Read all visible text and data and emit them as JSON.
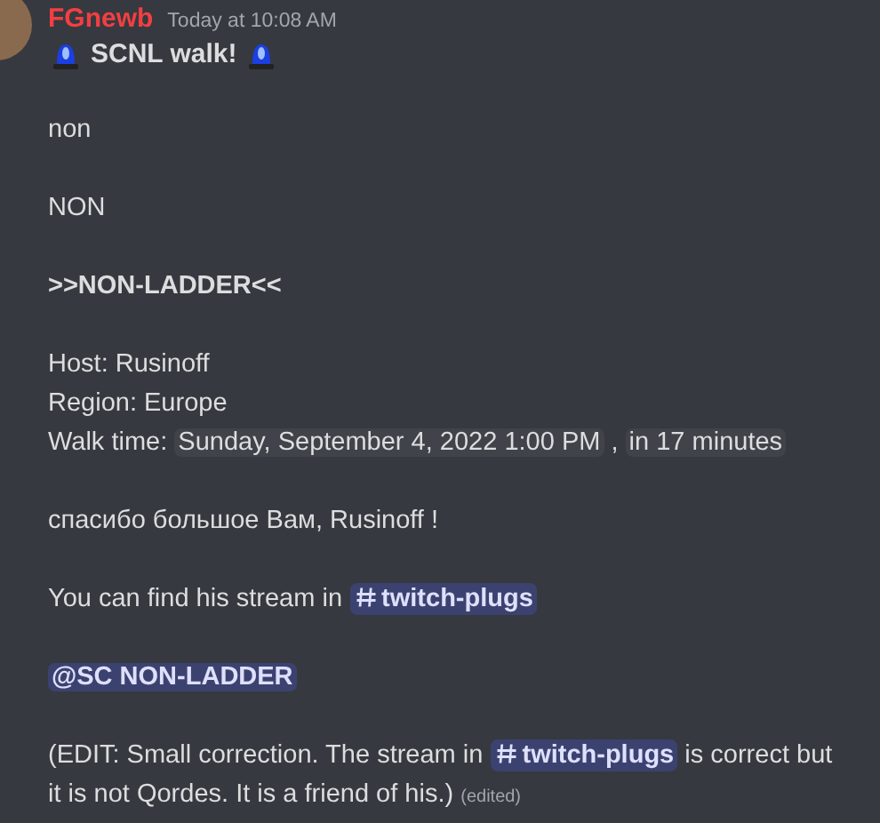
{
  "message": {
    "author": "FGnewb",
    "timestamp": "Today at 10:08 AM",
    "title": "SCNL walk!",
    "blocks": [
      [
        [
          {
            "kind": "text",
            "text": "non"
          }
        ]
      ],
      [
        [
          {
            "kind": "text",
            "text": "NON"
          }
        ]
      ],
      [
        [
          {
            "kind": "bold",
            "text": ">>NON-LADDER<<"
          }
        ]
      ],
      [
        [
          {
            "kind": "text",
            "text": "Host: Rusinoff"
          }
        ],
        [
          {
            "kind": "text",
            "text": "Region: Europe"
          }
        ],
        [
          {
            "kind": "text",
            "text": "Walk time:"
          },
          {
            "kind": "time",
            "text": "Sunday, September 4, 2022 1:00 PM"
          },
          {
            "kind": "text",
            "text": ","
          },
          {
            "kind": "time",
            "text": "in 17 minutes"
          }
        ]
      ],
      [
        [
          {
            "kind": "text",
            "text": "спасибо большое Вам, Rusinoff !"
          }
        ]
      ],
      [
        [
          {
            "kind": "text",
            "text": "You can find his stream in"
          },
          {
            "kind": "channel",
            "text": "twitch-plugs"
          }
        ]
      ],
      [
        [
          {
            "kind": "mention",
            "text": "@SC NON-LADDER"
          }
        ]
      ],
      [
        [
          {
            "kind": "text",
            "text": "(EDIT: Small correction. The stream in"
          },
          {
            "kind": "channel",
            "text": "twitch-plugs"
          },
          {
            "kind": "text",
            "text": "is correct but it is not Qordes. It is a friend of his.)"
          },
          {
            "kind": "edited",
            "text": "(edited)"
          }
        ]
      ]
    ]
  }
}
